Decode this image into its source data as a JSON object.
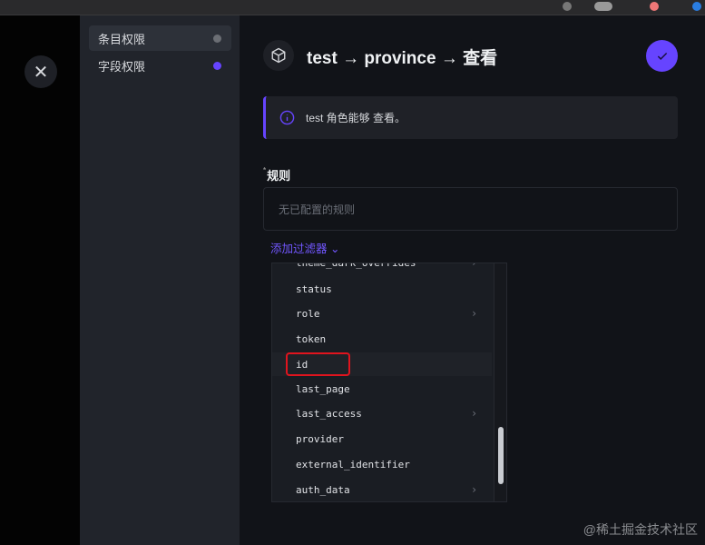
{
  "header": {
    "title": "test → province → 查看",
    "save_label": "确认"
  },
  "sidebar": {
    "items": [
      {
        "label": "条目权限",
        "dot_color": "#6b6e74",
        "active": true
      },
      {
        "label": "字段权限",
        "dot_color": "#6644ff",
        "active": false
      }
    ]
  },
  "notice": {
    "text": "test 角色能够 查看。"
  },
  "rules": {
    "label": "规则",
    "required_mark": "*",
    "empty_text": "无已配置的规则",
    "add_filter_label": "添加过滤器"
  },
  "dropdown": {
    "items": [
      {
        "label": "theme_dark_overrides",
        "has_children": true
      },
      {
        "label": "status",
        "has_children": false
      },
      {
        "label": "role",
        "has_children": true
      },
      {
        "label": "token",
        "has_children": false
      },
      {
        "label": "id",
        "has_children": false
      },
      {
        "label": "last_page",
        "has_children": false
      },
      {
        "label": "last_access",
        "has_children": true
      },
      {
        "label": "provider",
        "has_children": false
      },
      {
        "label": "external_identifier",
        "has_children": false
      },
      {
        "label": "auth_data",
        "has_children": true
      }
    ],
    "scroll_position": 0.9
  },
  "watermark": "@稀土掘金技术社区",
  "colors": {
    "accent": "#6644ff",
    "highlight": "#e0141e"
  }
}
